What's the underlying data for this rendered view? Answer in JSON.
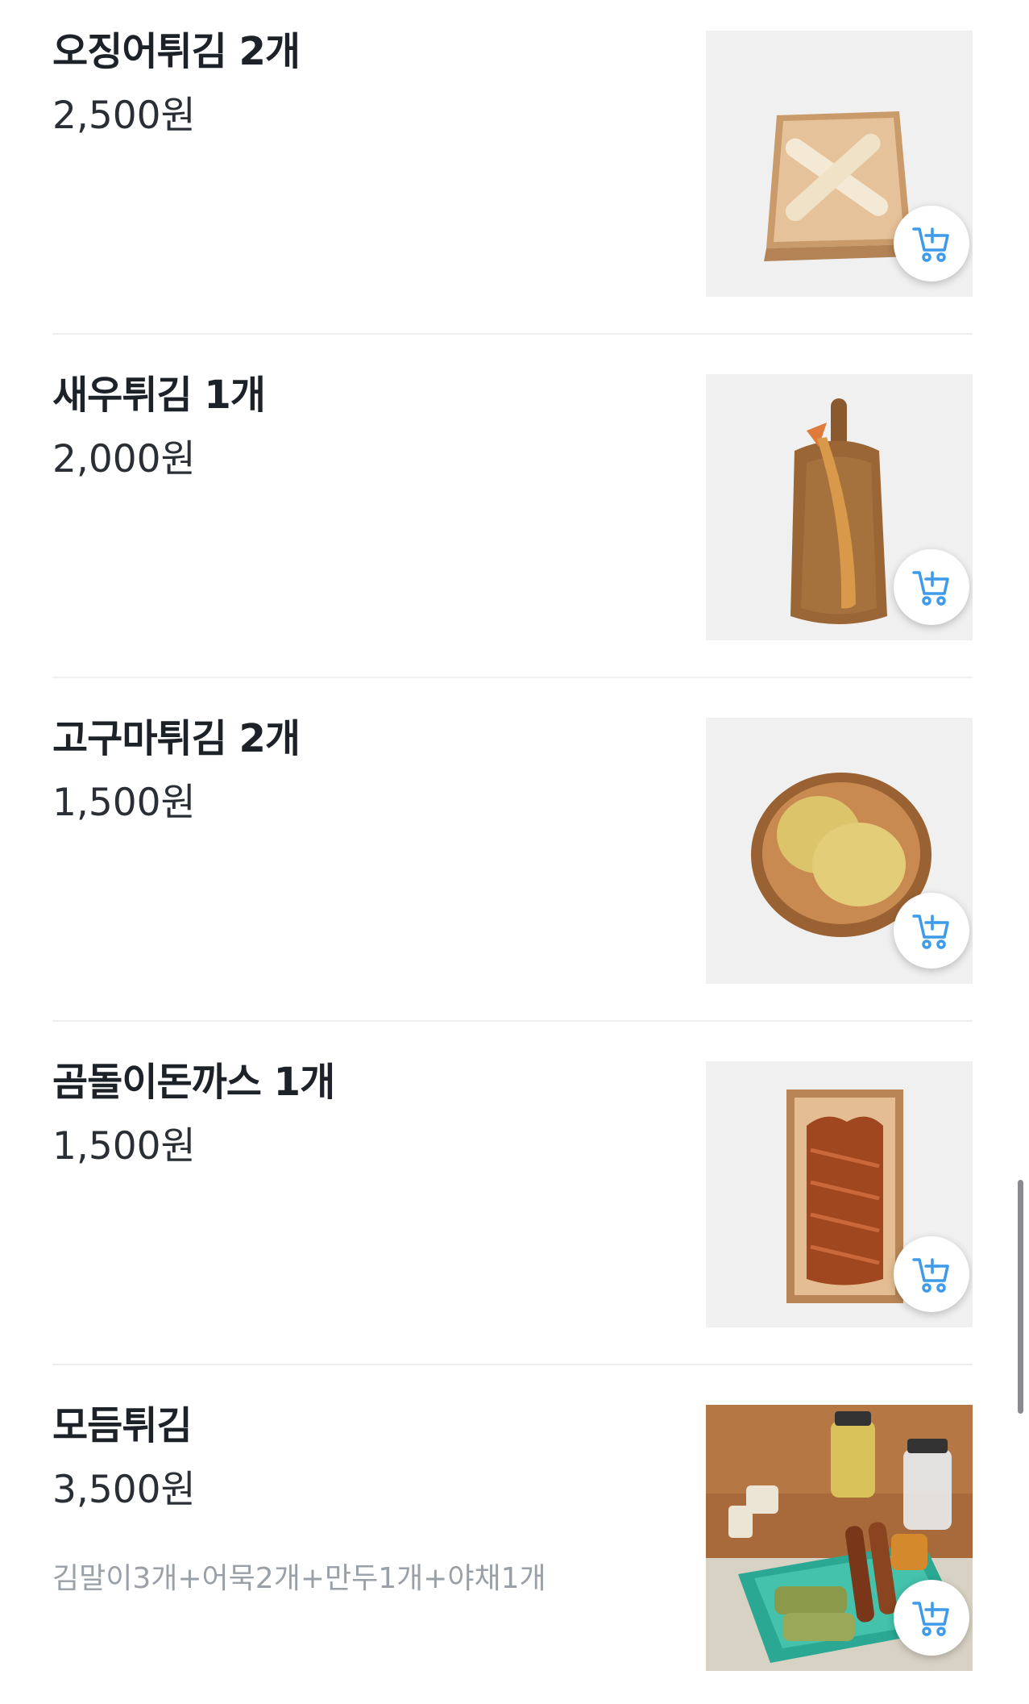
{
  "menu": {
    "items": [
      {
        "name": "오징어튀김 2개",
        "price": "2,500원",
        "description": "",
        "image_icon": "fried-squid-image",
        "cart_icon": "add-to-cart-icon"
      },
      {
        "name": "새우튀김 1개",
        "price": "2,000원",
        "description": "",
        "image_icon": "fried-shrimp-image",
        "cart_icon": "add-to-cart-icon"
      },
      {
        "name": "고구마튀김 2개",
        "price": "1,500원",
        "description": "",
        "image_icon": "fried-sweet-potato-image",
        "cart_icon": "add-to-cart-icon"
      },
      {
        "name": "곰돌이돈까스 1개",
        "price": "1,500원",
        "description": "",
        "image_icon": "bear-pork-cutlet-image",
        "cart_icon": "add-to-cart-icon"
      },
      {
        "name": "모듬튀김",
        "price": "3,500원",
        "description": "김말이3개+어묵2개+만두1개+야채1개",
        "image_icon": "assorted-fritters-image",
        "cart_icon": "add-to-cart-icon"
      }
    ]
  },
  "colors": {
    "accent": "#3d9be9",
    "divider": "#eeeff1",
    "description": "#9aa0a8",
    "text": "#1d2128"
  }
}
